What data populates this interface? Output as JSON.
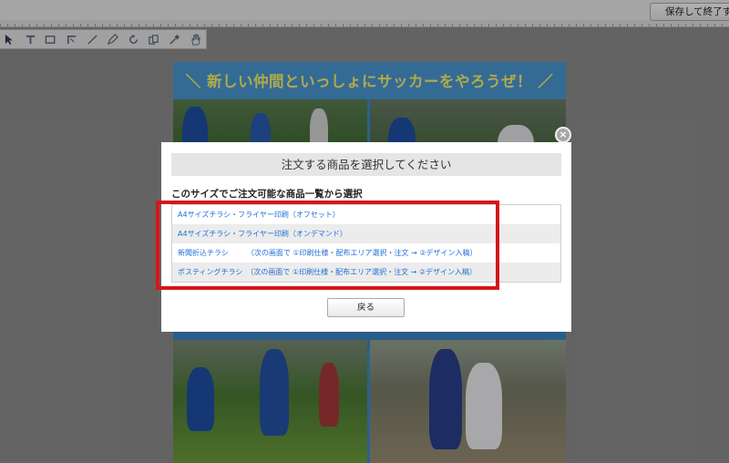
{
  "app": {
    "save_button_label": "保存して終了する"
  },
  "tools": [
    {
      "name": "select-arrow-icon"
    },
    {
      "name": "text-tool-icon"
    },
    {
      "name": "rectangle-tool-icon"
    },
    {
      "name": "corner-tool-icon"
    },
    {
      "name": "line-tool-icon"
    },
    {
      "name": "pen-tool-icon"
    },
    {
      "name": "rotate-tool-icon"
    },
    {
      "name": "layers-tool-icon"
    },
    {
      "name": "eyedropper-tool-icon"
    },
    {
      "name": "hand-tool-icon"
    }
  ],
  "flyer": {
    "headline": "＼ 新しい仲間といっしょにサッカーをやろうぜ！ ／"
  },
  "modal": {
    "title": "注文する商品を選択してください",
    "subtitle": "このサイズでご注文可能な商品一覧から選択",
    "items": [
      {
        "label": "A4サイズチラシ・フライヤー印刷（オフセット）"
      },
      {
        "label": "A4サイズチラシ・フライヤー印刷（オンデマンド）"
      },
      {
        "label": "新聞折込チラシ　　　（次の画面で ①印刷仕様・配布エリア選択・注文 → ②デザイン入稿）"
      },
      {
        "label": "ポスティングチラシ　（次の画面で ①印刷仕様・配布エリア選択・注文 → ②デザイン入稿）"
      }
    ],
    "back_button_label": "戻る",
    "close_symbol": "×"
  },
  "colors": {
    "link": "#1f6fd6",
    "highlight": "#d4161c",
    "flyer_blue": "#3c8ecd",
    "headline_yellow": "#fff36b"
  }
}
